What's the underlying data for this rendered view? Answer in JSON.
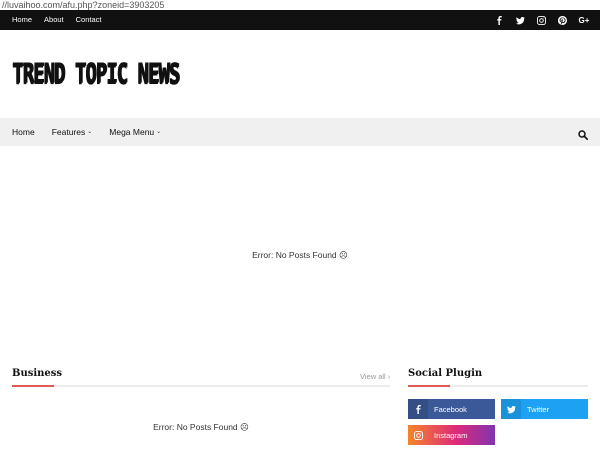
{
  "browser": {
    "url": "//luvaihoo.com/afu.php?zoneid=3903205"
  },
  "topbar": {
    "links": [
      "Home",
      "About",
      "Contact"
    ],
    "social_icons": [
      "facebook-icon",
      "twitter-icon",
      "instagram-icon",
      "pinterest-icon",
      "google-plus-icon"
    ],
    "gplus_text": "G+"
  },
  "header": {
    "logo_text": "TREND TOPIC NEWS"
  },
  "nav": {
    "items": [
      {
        "label": "Home"
      },
      {
        "label": "Features",
        "chevron": "⌄"
      },
      {
        "label": "Mega Menu",
        "chevron": "⌄"
      }
    ],
    "search_icon": "search-icon"
  },
  "main": {
    "error_text": "Error: No Posts Found ☹"
  },
  "business": {
    "title": "Business",
    "view_all": "View all ›",
    "error_text": "Error: No Posts Found ☹"
  },
  "sidebar": {
    "title": "Social Plugin",
    "buttons": [
      {
        "label": "Facebook",
        "color": "#3b5998"
      },
      {
        "label": "Twitter",
        "color": "#1da1f2"
      },
      {
        "label": "Instagram",
        "color": "#dd2a7b"
      }
    ]
  },
  "colors": {
    "accent": "#e05a55",
    "topbar": "#111111",
    "navbar": "#f0f0f0"
  }
}
